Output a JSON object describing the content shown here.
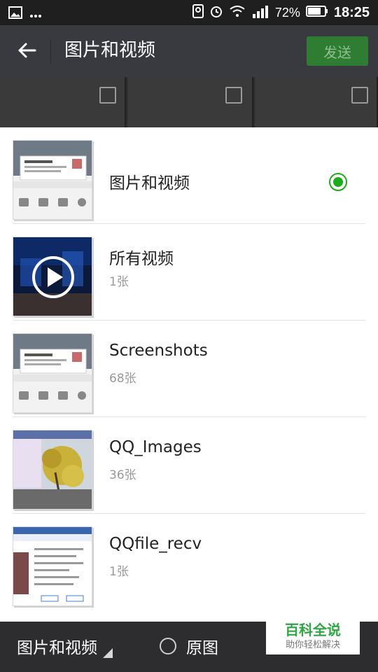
{
  "status_bar": {
    "battery_percent": "72%",
    "time": "18:25",
    "icons": [
      "image-icon",
      "more-dots-icon",
      "location-icon",
      "alarm-icon",
      "wifi-icon",
      "signal-icon",
      "battery-icon"
    ]
  },
  "header": {
    "title": "图片和视频",
    "send_label": "发送"
  },
  "albums": [
    {
      "name": "图片和视频",
      "count": "",
      "selected": true
    },
    {
      "name": "所有视频",
      "count": "1张",
      "selected": false
    },
    {
      "name": "Screenshots",
      "count": "68张",
      "selected": false
    },
    {
      "name": "QQ_Images",
      "count": "36张",
      "selected": false
    },
    {
      "name": "QQfile_recv",
      "count": "1张",
      "selected": false
    }
  ],
  "bottom_bar": {
    "album_label": "图片和视频",
    "original_label": "原图"
  },
  "watermark": {
    "title": "百科全说",
    "subtitle": "助你轻松解决"
  },
  "colors": {
    "accent_green": "#1aad19",
    "send_button_bg": "#2f7d32",
    "title_bar_bg": "#393a3f",
    "bottom_bar_bg": "#2d2d2f"
  }
}
